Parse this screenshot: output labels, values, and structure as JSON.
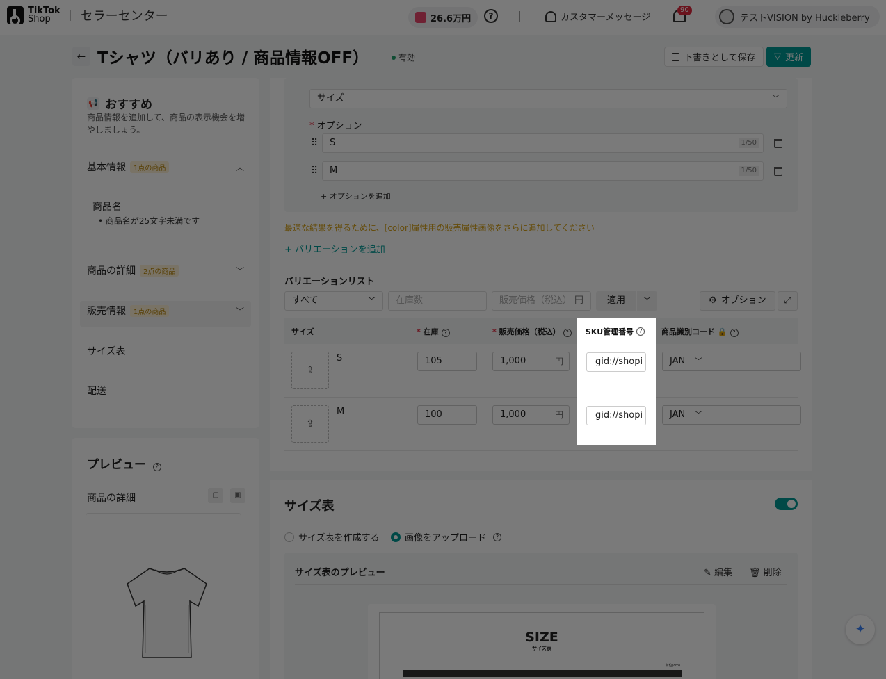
{
  "topbar": {
    "logo_line1": "TikTok",
    "logo_line2": "Shop",
    "title": "セラーセンター",
    "points": "26.6万円",
    "help": "?",
    "customer_message": "カスタマーメッセージ",
    "notif_count": "90",
    "shop_name": "テストVISION by Huckleberry"
  },
  "header": {
    "back": "←",
    "title": "Tシャツ（バリあり / 商品情報OFF）",
    "status": "有効",
    "draft_label": "下書きとして保存",
    "update_label": "更新"
  },
  "recommend": {
    "title": "おすすめ",
    "desc": "商品情報を追加して、商品の表示機会を増やしましょう。",
    "sections": [
      {
        "label": "基本情報",
        "tag": "1点の商品",
        "chev": "^"
      },
      {
        "label": "商品の詳細",
        "tag": "2点の商品",
        "chev": "v"
      },
      {
        "label": "販売情報",
        "tag": "1点の商品",
        "chev": "v"
      },
      {
        "label": "サイズ表"
      },
      {
        "label": "配送"
      }
    ],
    "item_name": "商品名",
    "item_bullet": "• 商品名が25文字未満です"
  },
  "preview": {
    "title": "プレビュー",
    "sub": "商品の詳細"
  },
  "variation": {
    "option_select": "サイズ",
    "option_label": "オプション",
    "options": [
      {
        "value": "S",
        "count": "1/50"
      },
      {
        "value": "M",
        "count": "1/50"
      }
    ],
    "add_option": "+ オプションを追加",
    "warning": "最適な結果を得るために、[color]属性用の販売属性画像をさらに追加してください",
    "add_variation": "+ バリエーションを追加",
    "list_title": "バリエーションリスト",
    "filter_all": "すべて",
    "stock_placeholder": "在庫数",
    "price_placeholder": "販売価格（税込）",
    "yen": "円",
    "apply": "適用",
    "options_btn": "オプション"
  },
  "table": {
    "headers": {
      "size": "サイズ",
      "stock": "在庫",
      "price": "販売価格（税込）",
      "sku": "SKU管理番号",
      "code": "商品識別コード"
    },
    "rows": [
      {
        "name": "S",
        "stock": "105",
        "price": "1,000",
        "sku": "gid://shopi",
        "code": "JAN"
      },
      {
        "name": "M",
        "stock": "100",
        "price": "1,000",
        "sku": "gid://shopi",
        "code": "JAN"
      }
    ]
  },
  "size_chart": {
    "title": "サイズ表",
    "radio_create": "サイズ表を作成する",
    "radio_upload": "画像をアップロード",
    "preview_title": "サイズ表のプレビュー",
    "edit": "編集",
    "delete": "削除",
    "img_heading": "SIZE",
    "img_sub": "サイズ表",
    "img_unit": "単位(cm)"
  },
  "colors": {
    "accent": "#009995",
    "badge": "#e0283e",
    "warning": "#d4a017"
  }
}
